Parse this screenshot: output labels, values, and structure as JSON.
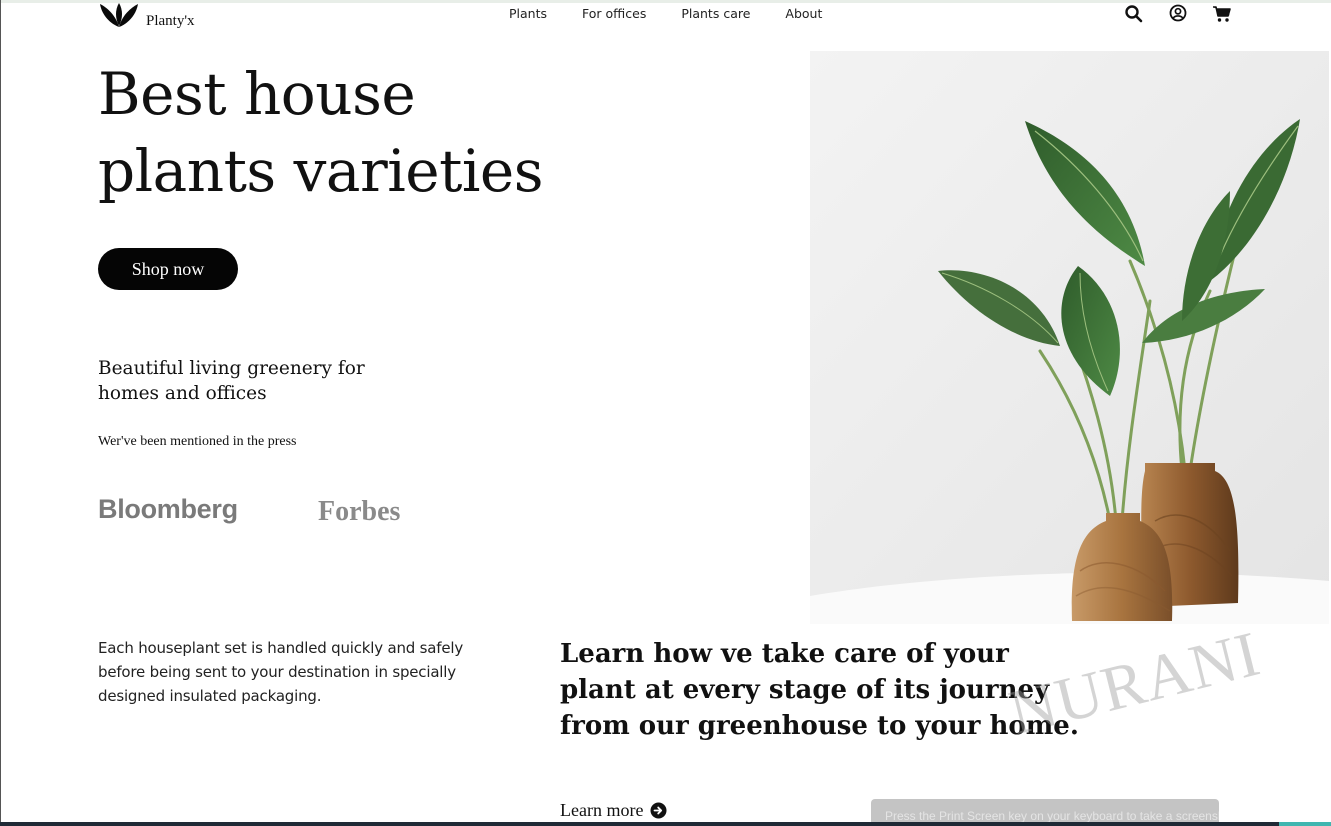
{
  "brand": {
    "name": "Planty'x"
  },
  "nav": {
    "items": [
      {
        "label": "Plants"
      },
      {
        "label": "For offices"
      },
      {
        "label": "Plants care"
      },
      {
        "label": "About"
      }
    ]
  },
  "header_icons": [
    "search-icon",
    "user-account-icon",
    "cart-icon"
  ],
  "hero": {
    "title": "Best house plants varieties",
    "cta_label": "Shop now",
    "tagline": "Beautiful living greenery for homes and offices",
    "press_label": "Wer've been mentioned in the press",
    "press": [
      "Bloomberg",
      "Forbes"
    ]
  },
  "info": {
    "packaging_text": "Each houseplant set is handled quickly and safely before being sent to your destination in specially designed insulated packaging.",
    "learn_heading": "Learn how ve take care of your plant at every stage of its journey from our greenhouse to your home.",
    "learn_more_label": "Learn more"
  },
  "watermark": "NURANI",
  "toast": {
    "text": "Press the Print Screen key on your keyboard to take a screenshot"
  },
  "colors": {
    "primary": "#050505",
    "background": "#ffffff",
    "press_gray": "#7a7a7a",
    "leaf_green": "#3f7a3a",
    "vase_wood": "#a8743f"
  }
}
